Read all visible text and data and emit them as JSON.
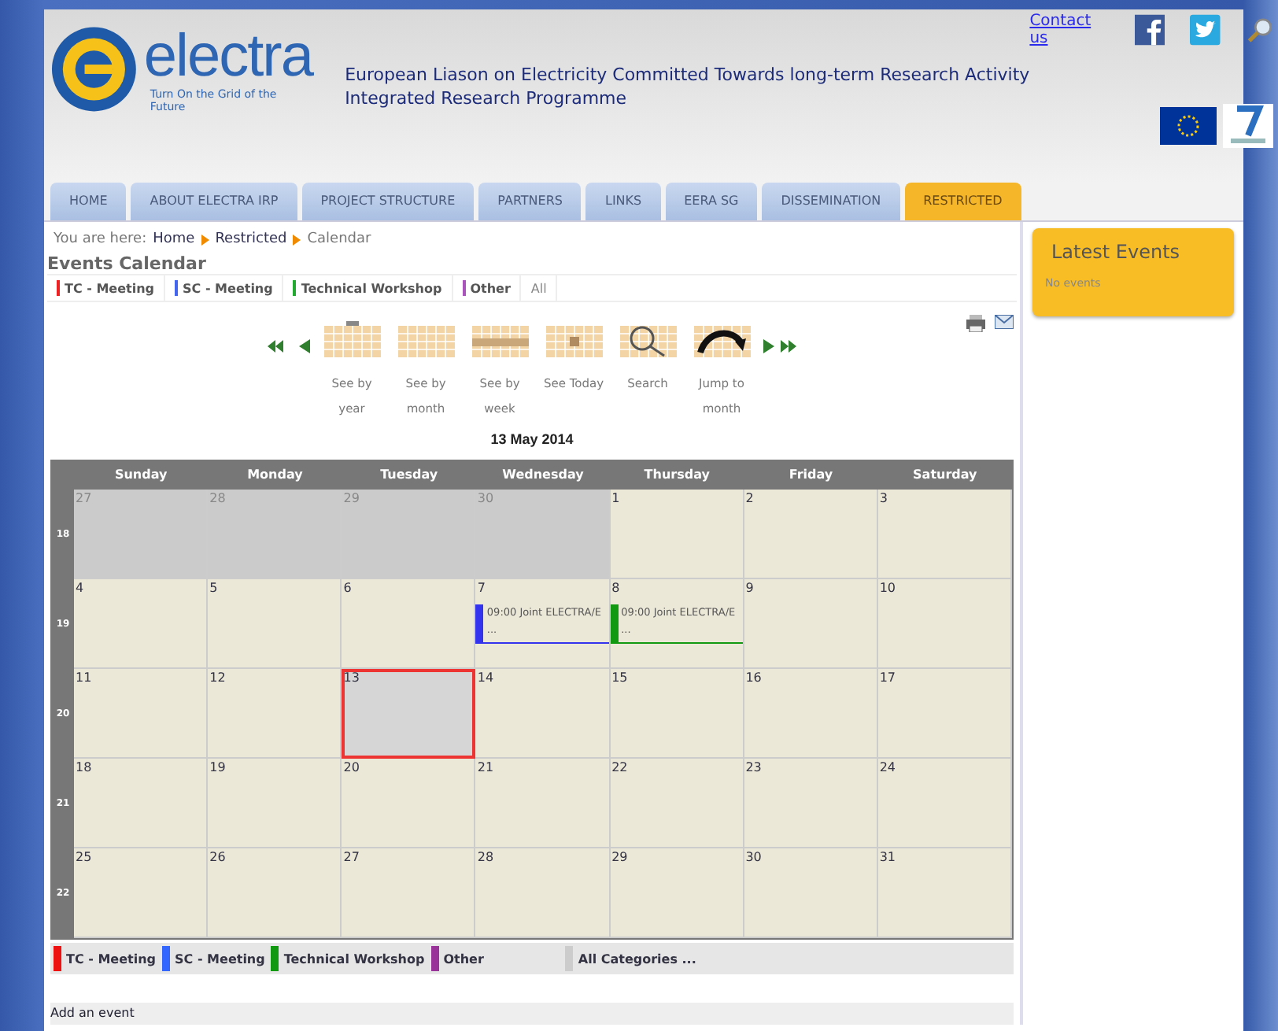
{
  "header": {
    "contact_link": "Contact us",
    "logo_text": "electra",
    "logo_tagline": "Turn On the Grid of the Future",
    "title_lines": [
      "European Liason on Electricity Committed Towards long-term Research Activity",
      "Integrated Research Programme"
    ]
  },
  "nav": [
    {
      "label": "HOME",
      "selected": false
    },
    {
      "label": "ABOUT ELECTRA IRP",
      "selected": false
    },
    {
      "label": "PROJECT STRUCTURE",
      "selected": false
    },
    {
      "label": "PARTNERS",
      "selected": false
    },
    {
      "label": "LINKS",
      "selected": false
    },
    {
      "label": "EERA SG",
      "selected": false
    },
    {
      "label": "DISSEMINATION",
      "selected": false
    },
    {
      "label": "RESTRICTED",
      "selected": true
    }
  ],
  "breadcrumb": {
    "prefix": "You are here:",
    "links": [
      "Home",
      "Restricted"
    ],
    "current": "Calendar"
  },
  "heading": "Events Calendar",
  "category_filter": [
    {
      "label": "TC - Meeting",
      "color": "#ee2222"
    },
    {
      "label": "SC - Meeting",
      "color": "#4466ee"
    },
    {
      "label": "Technical Workshop",
      "color": "#22aa33"
    },
    {
      "label": "Other",
      "color": "#aa55bb"
    },
    {
      "label": "All"
    }
  ],
  "toolbar": [
    {
      "kind": "year",
      "label": "See by year"
    },
    {
      "kind": "month",
      "label": "See by month"
    },
    {
      "kind": "week",
      "label": "See by week"
    },
    {
      "kind": "today",
      "label": "See Today"
    },
    {
      "kind": "search",
      "label": "Search"
    },
    {
      "kind": "jump",
      "label": "Jump to month"
    }
  ],
  "date_title": "13 May 2014",
  "calendar": {
    "columns": [
      "Sunday",
      "Monday",
      "Tuesday",
      "Wednesday",
      "Thursday",
      "Friday",
      "Saturday"
    ],
    "weeks": [
      {
        "week": "18",
        "days": [
          {
            "day": "27",
            "other_month": true
          },
          {
            "day": "28",
            "other_month": true
          },
          {
            "day": "29",
            "other_month": true
          },
          {
            "day": "30",
            "other_month": true
          },
          {
            "day": "1",
            "other_month": false
          },
          {
            "day": "2",
            "other_month": false
          },
          {
            "day": "3",
            "other_month": false
          }
        ]
      },
      {
        "week": "19",
        "days": [
          {
            "day": "4",
            "other_month": false
          },
          {
            "day": "5",
            "other_month": false
          },
          {
            "day": "6",
            "other_month": false
          },
          {
            "day": "7",
            "other_month": false,
            "events": [
              {
                "text": "09:00 Joint ELECTRA/E",
                "more": "...",
                "color": "#3333ee"
              }
            ]
          },
          {
            "day": "8",
            "other_month": false,
            "events": [
              {
                "text": "09:00 Joint ELECTRA/E",
                "more": "...",
                "color": "#119911"
              }
            ]
          },
          {
            "day": "9",
            "other_month": false
          },
          {
            "day": "10",
            "other_month": false
          }
        ]
      },
      {
        "week": "20",
        "days": [
          {
            "day": "11",
            "other_month": false
          },
          {
            "day": "12",
            "other_month": false
          },
          {
            "day": "13",
            "other_month": false,
            "selected": true
          },
          {
            "day": "14",
            "other_month": false
          },
          {
            "day": "15",
            "other_month": false
          },
          {
            "day": "16",
            "other_month": false
          },
          {
            "day": "17",
            "other_month": false
          }
        ]
      },
      {
        "week": "21",
        "days": [
          {
            "day": "18",
            "other_month": false
          },
          {
            "day": "19",
            "other_month": false
          },
          {
            "day": "20",
            "other_month": false
          },
          {
            "day": "21",
            "other_month": false
          },
          {
            "day": "22",
            "other_month": false
          },
          {
            "day": "23",
            "other_month": false
          },
          {
            "day": "24",
            "other_month": false
          }
        ]
      },
      {
        "week": "22",
        "days": [
          {
            "day": "25",
            "other_month": false
          },
          {
            "day": "26",
            "other_month": false
          },
          {
            "day": "27",
            "other_month": false
          },
          {
            "day": "28",
            "other_month": false
          },
          {
            "day": "29",
            "other_month": false
          },
          {
            "day": "30",
            "other_month": false
          },
          {
            "day": "31",
            "other_month": false
          }
        ]
      }
    ]
  },
  "legend": [
    {
      "label": "TC - Meeting",
      "color": "#ee1111"
    },
    {
      "label": "SC - Meeting",
      "color": "#3366ff"
    },
    {
      "label": "Technical Workshop",
      "color": "#119911"
    },
    {
      "label": "Other",
      "color": "#993399"
    },
    {
      "label": "All Categories ...",
      "color": "#cccccc"
    }
  ],
  "add_event": "Add an event",
  "sidebar": {
    "title": "Latest Events",
    "empty_text": "No events"
  }
}
